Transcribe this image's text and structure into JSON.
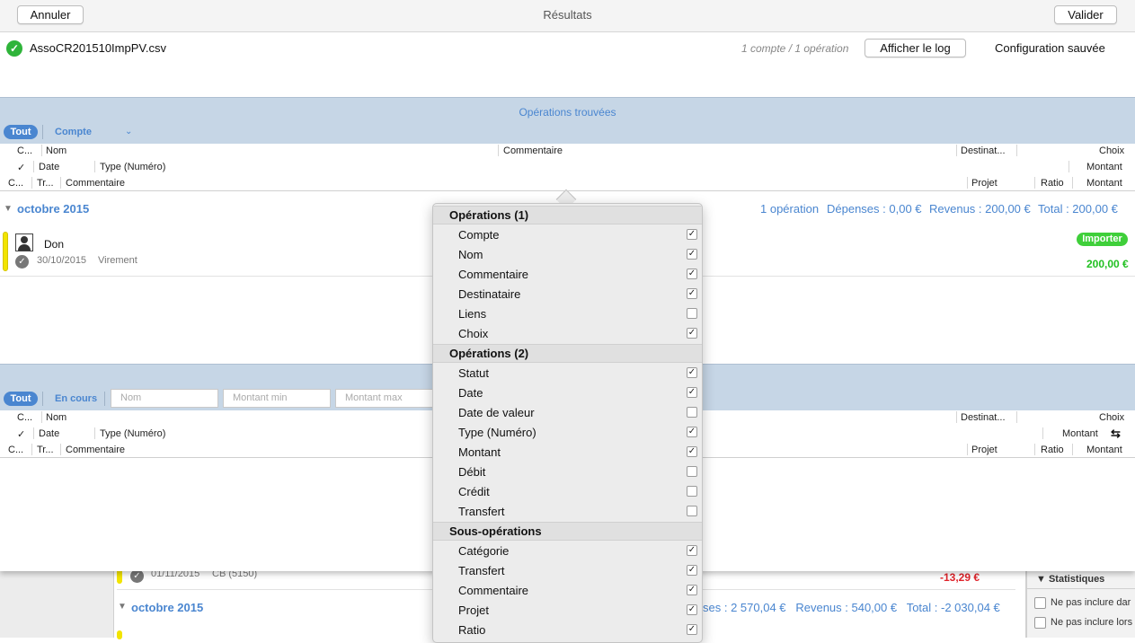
{
  "toolbar": {
    "cancel": "Annuler",
    "title": "Résultats",
    "validate": "Valider"
  },
  "file": {
    "name": "AssoCR201510ImpPV.csv",
    "summary": "1 compte / 1 opération",
    "show_log": "Afficher le log",
    "config": "Configuration sauvée"
  },
  "found": {
    "title": "Opérations trouvées",
    "filter_all": "Tout",
    "filter_account": "Compte",
    "headers": {
      "r1": [
        "C...",
        "Nom",
        "Commentaire",
        "Destinat...",
        "Choix"
      ],
      "r2": [
        "✓",
        "Date",
        "Type (Numéro)",
        "Montant"
      ],
      "r3": [
        "C...",
        "Tr...",
        "Commentaire",
        "Projet",
        "Ratio",
        "Montant"
      ]
    },
    "month": "octobre 2015",
    "summary": {
      "ops": "1 opération",
      "expenses": "Dépenses : 0,00 €",
      "income": "Revenus : 200,00 €",
      "total": "Total : 200,00 €"
    },
    "row": {
      "name": "Don",
      "date": "30/10/2015",
      "type": "Virement",
      "badge": "Importer",
      "amount": "200,00 €"
    }
  },
  "existing": {
    "filter_all": "Tout",
    "filter_current": "En cours",
    "name_ph": "Nom",
    "min_ph": "Montant min",
    "max_ph": "Montant max",
    "headers": {
      "r1": [
        "C...",
        "Nom",
        "Destinat...",
        "Choix"
      ],
      "r2": [
        "✓",
        "Date",
        "Type (Numéro)",
        "Montant"
      ],
      "r3": [
        "C...",
        "Tr...",
        "Commentaire",
        "Projet",
        "Ratio",
        "Montant"
      ]
    }
  },
  "background": {
    "date": "01/11/2015",
    "type": "CB (5150)",
    "amount": "-13,29 €",
    "month": "octobre 2015",
    "summary": "ses : 2 570,04 €   Revenus : 540,00 €   Total : -2 030,04 €",
    "stats": "Statistiques",
    "opt1": "Ne pas inclure dar",
    "opt2": "Ne pas inclure lors"
  },
  "popup": {
    "groups": [
      {
        "title": "Opérations (1)",
        "items": [
          {
            "label": "Compte",
            "checked": true
          },
          {
            "label": "Nom",
            "checked": true
          },
          {
            "label": "Commentaire",
            "checked": true
          },
          {
            "label": "Destinataire",
            "checked": true
          },
          {
            "label": "Liens",
            "checked": false
          },
          {
            "label": "Choix",
            "checked": true
          }
        ]
      },
      {
        "title": "Opérations (2)",
        "items": [
          {
            "label": "Statut",
            "checked": true
          },
          {
            "label": "Date",
            "checked": true
          },
          {
            "label": "Date de valeur",
            "checked": false
          },
          {
            "label": "Type (Numéro)",
            "checked": true
          },
          {
            "label": "Montant",
            "checked": true
          },
          {
            "label": "Débit",
            "checked": false
          },
          {
            "label": "Crédit",
            "checked": false
          },
          {
            "label": "Transfert",
            "checked": false
          }
        ]
      },
      {
        "title": "Sous-opérations",
        "items": [
          {
            "label": "Catégorie",
            "checked": true
          },
          {
            "label": "Transfert",
            "checked": true
          },
          {
            "label": "Commentaire",
            "checked": true
          },
          {
            "label": "Projet",
            "checked": true
          },
          {
            "label": "Ratio",
            "checked": true
          }
        ]
      }
    ]
  },
  "colors": {
    "accent": "#4a86d0",
    "band": "#c6d6e6",
    "green": "#2fb43a",
    "red": "#e0242b",
    "yellow": "#f2e400"
  }
}
